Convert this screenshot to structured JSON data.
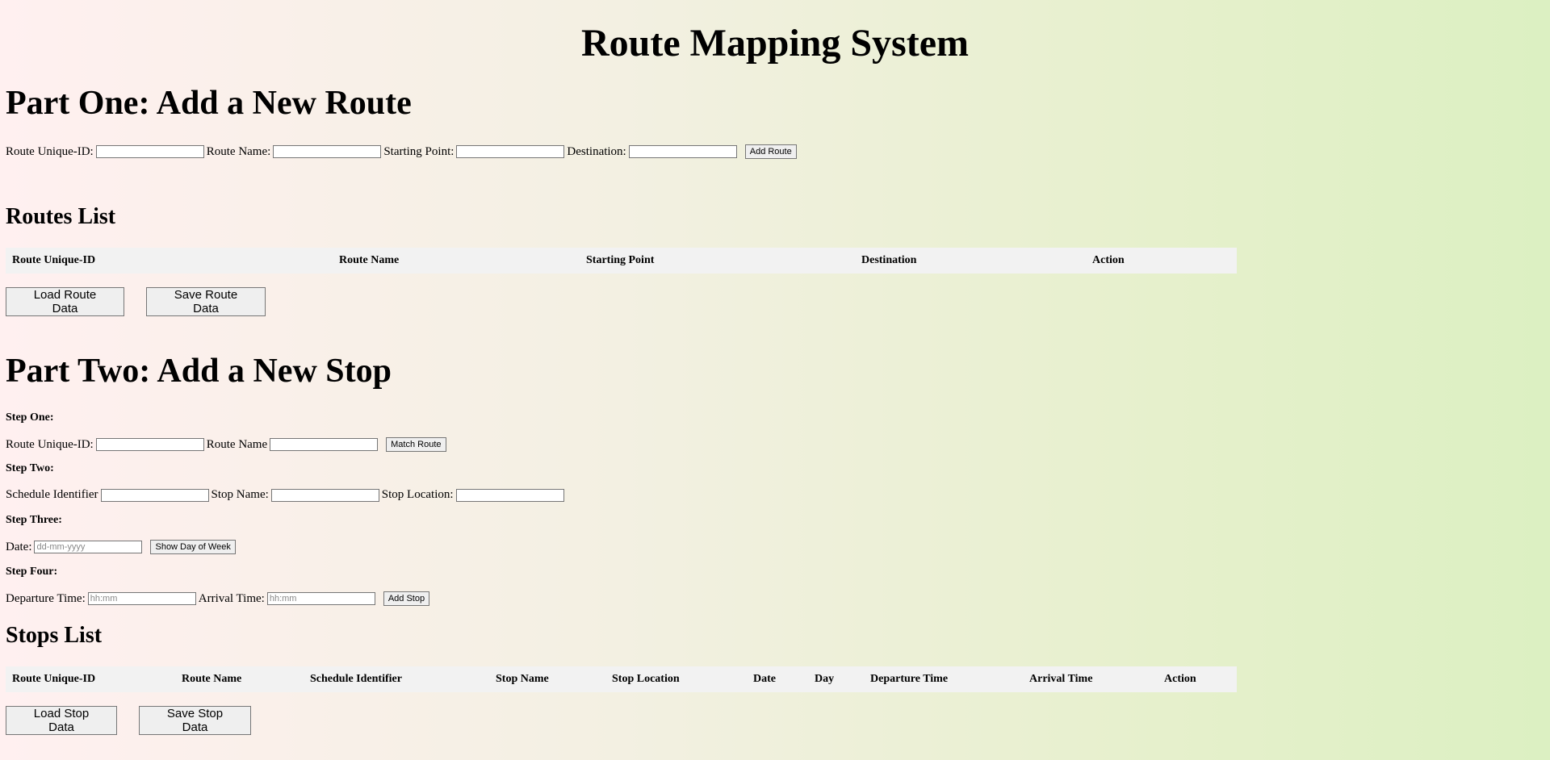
{
  "title": "Route Mapping System",
  "part_one": {
    "heading": "Part One: Add a New Route",
    "labels": {
      "route_id": "Route Unique-ID:",
      "route_name": "Route Name:",
      "starting_point": "Starting Point:",
      "destination": "Destination:"
    },
    "add_button": "Add Route"
  },
  "routes_list": {
    "heading": "Routes List",
    "columns": [
      "Route Unique-ID",
      "Route Name",
      "Starting Point",
      "Destination",
      "Action"
    ],
    "load_button": "Load Route Data",
    "save_button": "Save Route Data"
  },
  "part_two": {
    "heading": "Part Two: Add a New Stop",
    "step_one": {
      "label": "Step One:",
      "route_id_label": "Route Unique-ID:",
      "route_name_label": "Route Name",
      "match_button": "Match Route"
    },
    "step_two": {
      "label": "Step Two:",
      "schedule_label": "Schedule Identifier",
      "stop_name_label": "Stop Name:",
      "stop_location_label": "Stop Location:"
    },
    "step_three": {
      "label": "Step Three:",
      "date_label": "Date:",
      "date_placeholder": "dd-mm-yyyy",
      "show_day_button": "Show Day of Week"
    },
    "step_four": {
      "label": "Step Four:",
      "departure_label": "Departure Time:",
      "departure_placeholder": "hh:mm",
      "arrival_label": "Arrival Time:",
      "arrival_placeholder": "hh:mm",
      "add_stop_button": "Add Stop"
    }
  },
  "stops_list": {
    "heading": "Stops List",
    "columns": [
      "Route Unique-ID",
      "Route Name",
      "Schedule Identifier",
      "Stop Name",
      "Stop Location",
      "Date",
      "Day",
      "Departure Time",
      "Arrival Time",
      "Action"
    ],
    "load_button": "Load Stop Data",
    "save_button": "Save Stop Data"
  }
}
